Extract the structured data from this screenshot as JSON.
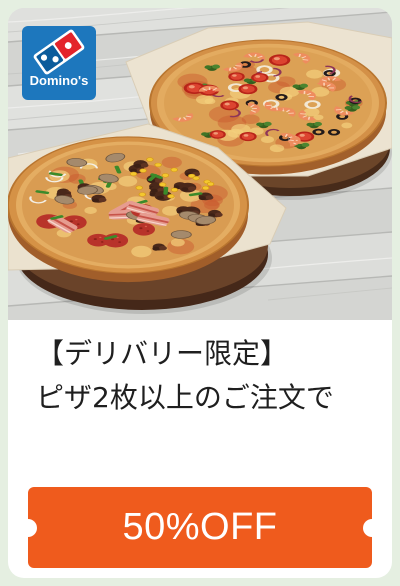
{
  "brand": {
    "logo_text": "Domino's"
  },
  "coupon": {
    "headline": "【デリバリー限定】",
    "description": "ピザ2枚以上のご注文で",
    "discount_label": "50%OFF"
  },
  "images": {
    "hero_image": "pizza-photo",
    "logo_icon": "domino-tile-icon"
  },
  "colors": {
    "page_background": "#e5efe1",
    "card_background": "#ffffff",
    "accent": "#ef5b1d",
    "logo_blue": "#1d77bd",
    "text": "#1f1f1f"
  }
}
